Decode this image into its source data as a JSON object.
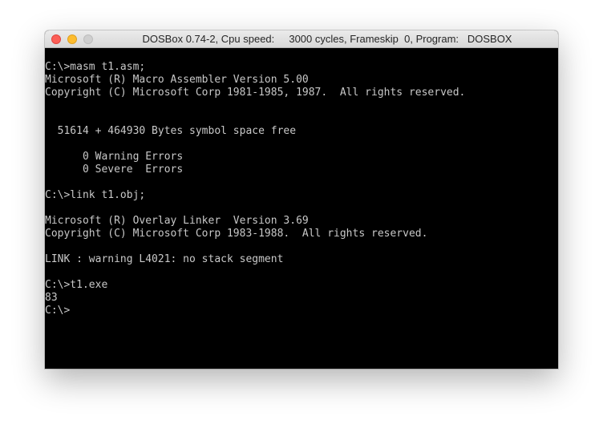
{
  "window": {
    "title": "DOSBox 0.74-2, Cpu speed:     3000 cycles, Frameskip  0, Program:   DOSBOX"
  },
  "console": {
    "lines": [
      "C:\\>masm t1.asm;",
      "Microsoft (R) Macro Assembler Version 5.00",
      "Copyright (C) Microsoft Corp 1981-1985, 1987.  All rights reserved.",
      "",
      "",
      "  51614 + 464930 Bytes symbol space free",
      "",
      "      0 Warning Errors",
      "      0 Severe  Errors",
      "",
      "C:\\>link t1.obj;",
      "",
      "Microsoft (R) Overlay Linker  Version 3.69",
      "Copyright (C) Microsoft Corp 1983-1988.  All rights reserved.",
      "",
      "LINK : warning L4021: no stack segment",
      "",
      "C:\\>t1.exe",
      "83",
      "C:\\>"
    ]
  }
}
